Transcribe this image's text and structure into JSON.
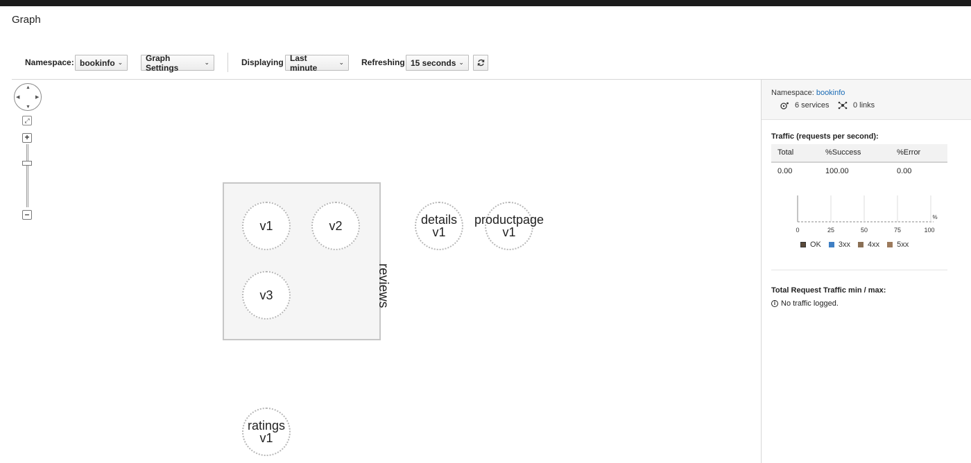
{
  "page": {
    "title": "Graph"
  },
  "toolbar": {
    "namespace_label": "Namespace:",
    "namespace_value": "bookinfo",
    "graph_settings": "Graph Settings",
    "displaying_label": "Displaying",
    "displaying_value": "Last minute",
    "refreshing_label": "Refreshing",
    "refreshing_value": "15 seconds",
    "refresh_icon": "refresh-icon"
  },
  "graph": {
    "group_label": "reviews",
    "nodes": {
      "reviews_v1": "v1",
      "reviews_v2": "v2",
      "reviews_v3": "v3",
      "details_name": "details",
      "details_version": "v1",
      "productpage_name": "productpage",
      "productpage_version": "v1",
      "ratings_name": "ratings",
      "ratings_version": "v1"
    }
  },
  "side_panel": {
    "namespace_label": "Namespace:",
    "namespace_value": "bookinfo",
    "services": "6 services",
    "links": "0 links",
    "traffic_title": "Traffic (requests per second):",
    "table": {
      "headers": [
        "Total",
        "%Success",
        "%Error"
      ],
      "row": [
        "0.00",
        "100.00",
        "0.00"
      ]
    },
    "chart_ticks": [
      "0",
      "25",
      "50",
      "75",
      "100"
    ],
    "chart_unit": "%",
    "legend": [
      {
        "label": "OK",
        "color": "#5a4a3a"
      },
      {
        "label": "3xx",
        "color": "#3f7fc4"
      },
      {
        "label": "4xx",
        "color": "#8a6f55"
      },
      {
        "label": "5xx",
        "color": "#9c7a5c"
      }
    ],
    "min_max_title": "Total Request Traffic min / max:",
    "no_traffic": "No traffic logged."
  }
}
